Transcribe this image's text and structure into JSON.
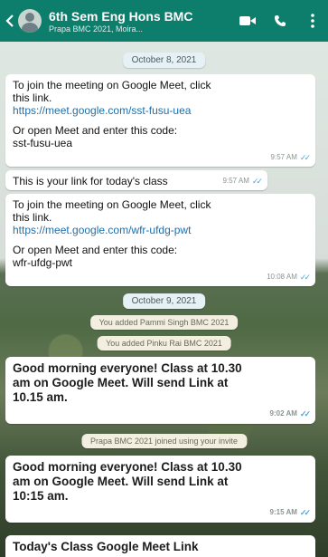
{
  "header": {
    "title": "6th Sem Eng Hons BMC",
    "subtitle": "Prapa BMC 2021, Moira...",
    "colors": {
      "bar": "#0d7d6c"
    }
  },
  "chat": {
    "date1": "October 8, 2021",
    "msg1": {
      "line1": "To join the meeting on Google Meet, click",
      "line2": "this link.",
      "link": "https://meet.google.com/sst-fusu-uea",
      "line3": "Or open Meet and enter this code:",
      "code": "sst-fusu-uea",
      "time": "9:57 AM"
    },
    "msg2": {
      "text": "This is your link for today's class",
      "time": "9:57 AM"
    },
    "msg3": {
      "line1": "To join the meeting on Google Meet, click",
      "line2": "this link.",
      "link": "https://meet.google.com/wfr-ufdg-pwt",
      "line3": "Or open Meet and enter this code:",
      "code": "wfr-ufdg-pwt",
      "time": "10:08 AM"
    },
    "date2": "October 9, 2021",
    "sys1": "You added Pammi Singh BMC 2021",
    "sys2": "You added Pinku Rai BMC 2021",
    "msg4": {
      "line1": "Good morning everyone! Class at 10.30",
      "line2": "am on Google Meet. Will send Link at",
      "line3": "10.15 am.",
      "time": "9:02 AM"
    },
    "sys3": "Prapa BMC 2021 joined using your invite",
    "msg5": {
      "line1": "Good morning everyone! Class at 10.30",
      "line2": "am on Google Meet. Will send Link at",
      "line3": "10:15 am.",
      "time": "9:15 AM"
    },
    "msg6": {
      "text": "Today's Class Google Meet Link"
    }
  },
  "icons": [
    "back-arrow-icon",
    "avatar",
    "video-call-icon",
    "voice-call-icon",
    "more-options-icon",
    "double-tick-icon"
  ]
}
